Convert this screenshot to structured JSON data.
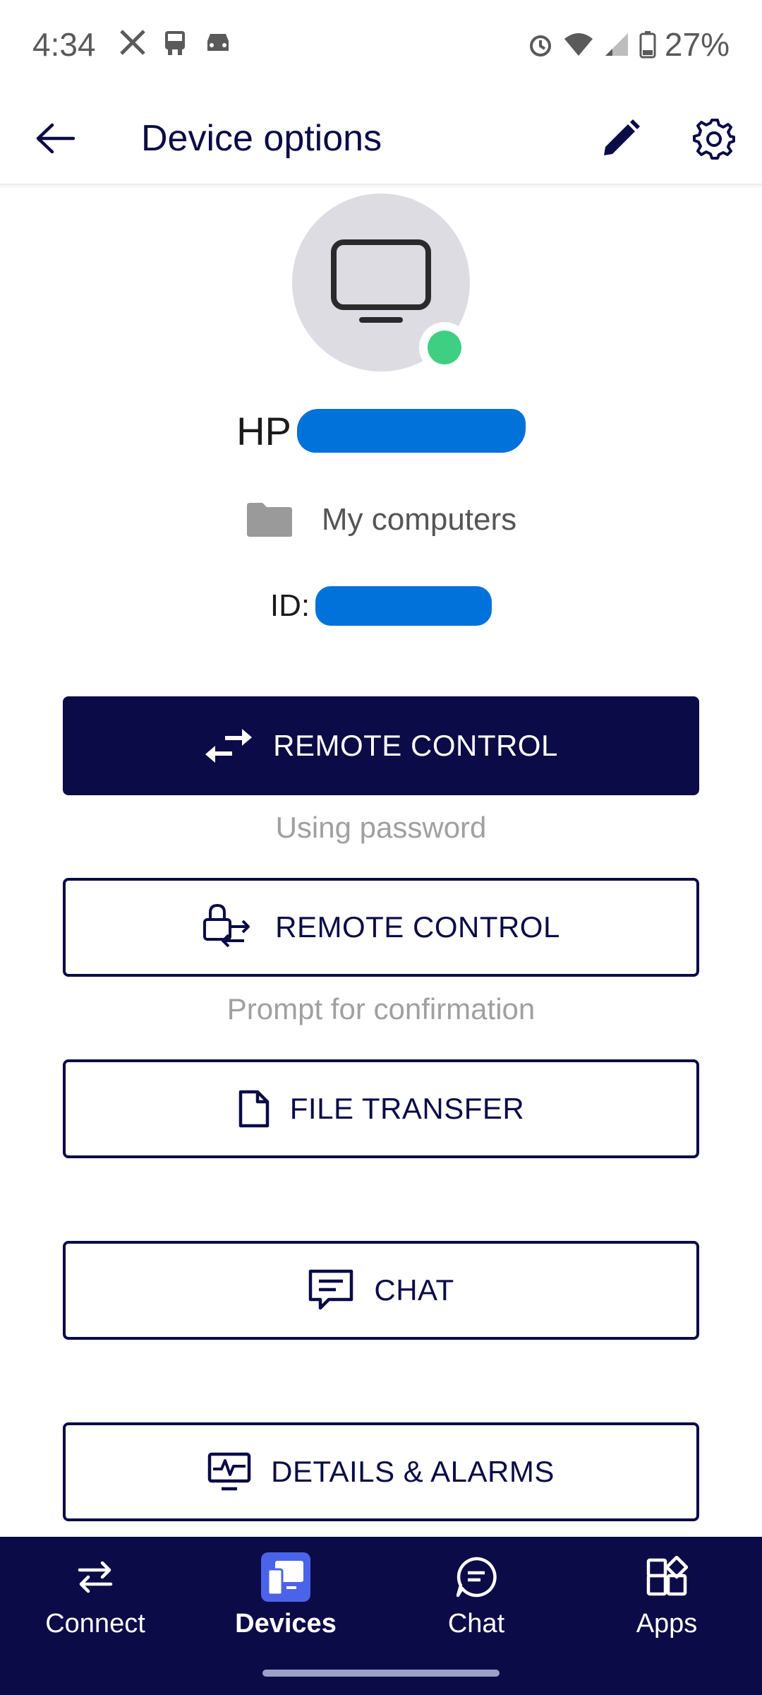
{
  "status_bar": {
    "time": "4:34",
    "battery": "27%",
    "left_icons": [
      "x-icon",
      "transit-icon",
      "car-icon"
    ],
    "right_icons": [
      "alarm-icon",
      "wifi-icon",
      "signal-icon",
      "battery-icon"
    ]
  },
  "app_bar": {
    "title": "Device options"
  },
  "device": {
    "name_prefix": "HP",
    "group": "My computers",
    "id_label": "ID:",
    "status_color": "#3fcf82"
  },
  "actions": {
    "remote_control_primary": {
      "label": "REMOTE CONTROL",
      "caption": "Using password"
    },
    "remote_control_secondary": {
      "label": "REMOTE CONTROL",
      "caption": "Prompt for confirmation"
    },
    "file_transfer": {
      "label": "FILE TRANSFER"
    },
    "chat": {
      "label": "CHAT"
    },
    "details_alarms": {
      "label": "DETAILS & ALARMS"
    }
  },
  "bottom_nav": {
    "items": [
      {
        "label": "Connect"
      },
      {
        "label": "Devices"
      },
      {
        "label": "Chat"
      },
      {
        "label": "Apps"
      }
    ],
    "active": "Devices"
  },
  "colors": {
    "brand_navy": "#0b0b47",
    "redaction_blue": "#0072da",
    "active_nav": "#4b63e8"
  }
}
